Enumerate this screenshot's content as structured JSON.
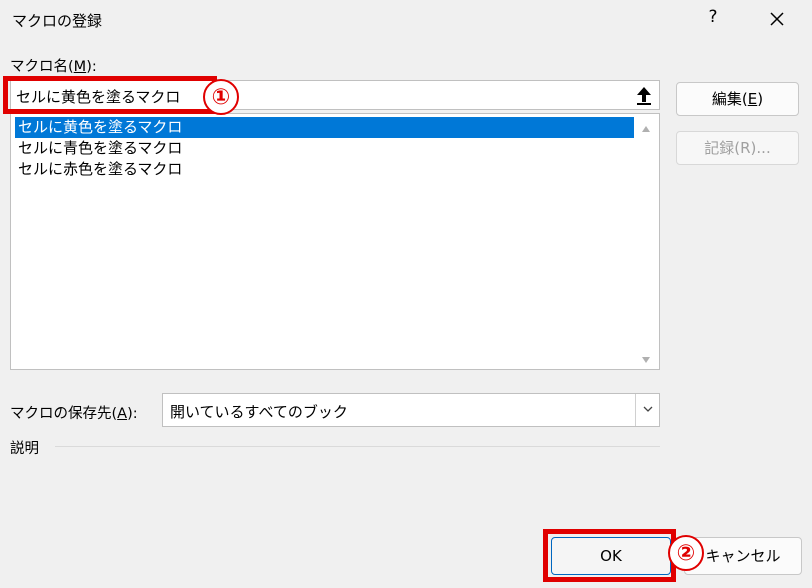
{
  "dialog": {
    "title": "マクロの登録",
    "help_label": "?",
    "macro_name_label": {
      "before": "マクロ名(",
      "key": "M",
      "after": "):"
    },
    "macro_name_value": "セルに黄色を塗るマクロ",
    "macros": [
      "セルに黄色を塗るマクロ",
      "セルに青色を塗るマクロ",
      "セルに赤色を塗るマクロ"
    ],
    "selected_index": 0,
    "edit_button": {
      "before": "編集(",
      "key": "E",
      "after": ")"
    },
    "record_button": "記録(R)...",
    "store_label": {
      "before": "マクロの保存先(",
      "key": "A",
      "after": "):"
    },
    "store_value": "開いているすべてのブック",
    "description_label": "説明",
    "ok_button": "OK",
    "cancel_button": "キャンセル"
  },
  "annotations": {
    "badge1": "①",
    "badge2": "②",
    "color": "#e00000"
  },
  "colors": {
    "selection": "#0078d7",
    "background": "#f0f0f0",
    "ok_border": "#0067c0"
  },
  "icons": {
    "close": "close-icon",
    "collapse": "collapse-dialog-icon",
    "scroll_up": "scroll-up-arrow-icon",
    "scroll_down": "scroll-down-arrow-icon",
    "dropdown": "chevron-down-icon"
  }
}
